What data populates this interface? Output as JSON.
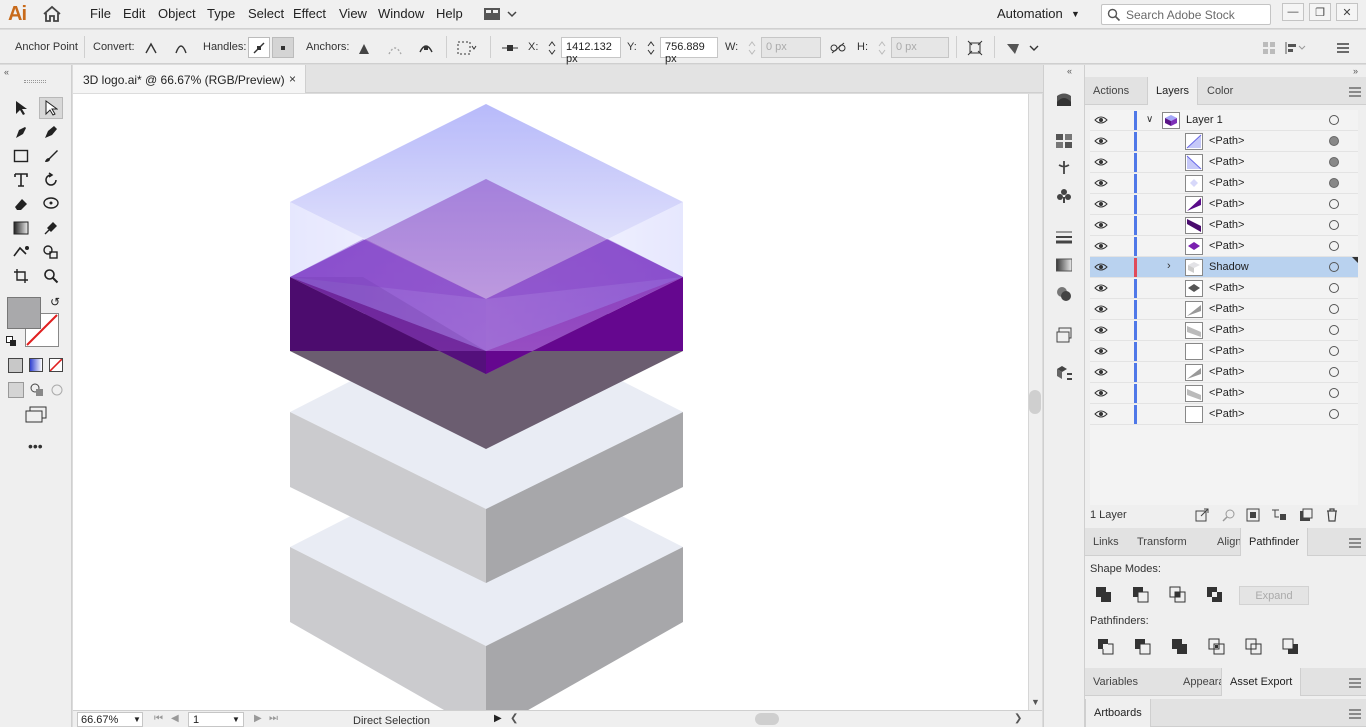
{
  "app": {
    "logo": "Ai",
    "menu": [
      "File",
      "Edit",
      "Object",
      "Type",
      "Select",
      "Effect",
      "View",
      "Window",
      "Help"
    ],
    "workspace": "Automation",
    "search_placeholder": "Search Adobe Stock"
  },
  "control_bar": {
    "tool_name": "Anchor Point",
    "convert_label": "Convert:",
    "handles_label": "Handles:",
    "anchors_label": "Anchors:",
    "x_label": "X:",
    "x_value": "1412.132 px",
    "y_label": "Y:",
    "y_value": "756.889 px",
    "w_label": "W:",
    "w_value": "0 px",
    "h_label": "H:",
    "h_value": "0 px"
  },
  "document": {
    "tab_title": "3D logo.ai* @ 66.67% (RGB/Preview)",
    "close_glyph": "×"
  },
  "status_bar": {
    "zoom": "66.67%",
    "artboard": "1",
    "tool_status": "Direct Selection"
  },
  "layers_panel": {
    "tabs": [
      "Actions",
      "Layers",
      "Color"
    ],
    "active_tab": "Layers",
    "parent_layer": "Layer 1",
    "rows": [
      {
        "name": "<Path>",
        "target_filled": true
      },
      {
        "name": "<Path>",
        "target_filled": true
      },
      {
        "name": "<Path>",
        "target_filled": true
      },
      {
        "name": "<Path>",
        "target_filled": false
      },
      {
        "name": "<Path>",
        "target_filled": false
      },
      {
        "name": "<Path>",
        "target_filled": false
      },
      {
        "name": "Shadow",
        "target_filled": false,
        "selected": true,
        "group": true
      },
      {
        "name": "<Path>",
        "target_filled": false
      },
      {
        "name": "<Path>",
        "target_filled": false
      },
      {
        "name": "<Path>",
        "target_filled": false
      },
      {
        "name": "<Path>",
        "target_filled": false
      },
      {
        "name": "<Path>",
        "target_filled": false
      },
      {
        "name": "<Path>",
        "target_filled": false
      },
      {
        "name": "<Path>",
        "target_filled": false
      }
    ],
    "layer_count": "1 Layer"
  },
  "pathfinder_panel": {
    "tabs": [
      "Links",
      "Transform",
      "Align",
      "Pathfinder"
    ],
    "active_tab": "Pathfinder",
    "shape_modes_label": "Shape Modes:",
    "expand_label": "Expand",
    "pathfinders_label": "Pathfinders:"
  },
  "asset_panel": {
    "tabs": [
      "Variables",
      "Appearance",
      "Asset Export"
    ],
    "active_tab": "Asset Export"
  },
  "artboards_panel": {
    "tabs": [
      "Artboards"
    ]
  },
  "colors": {
    "accent": "#4f78e8",
    "selected_row": "#b9d2ef",
    "purple": "#6a1b9a",
    "shadow": "#6b5d70"
  }
}
